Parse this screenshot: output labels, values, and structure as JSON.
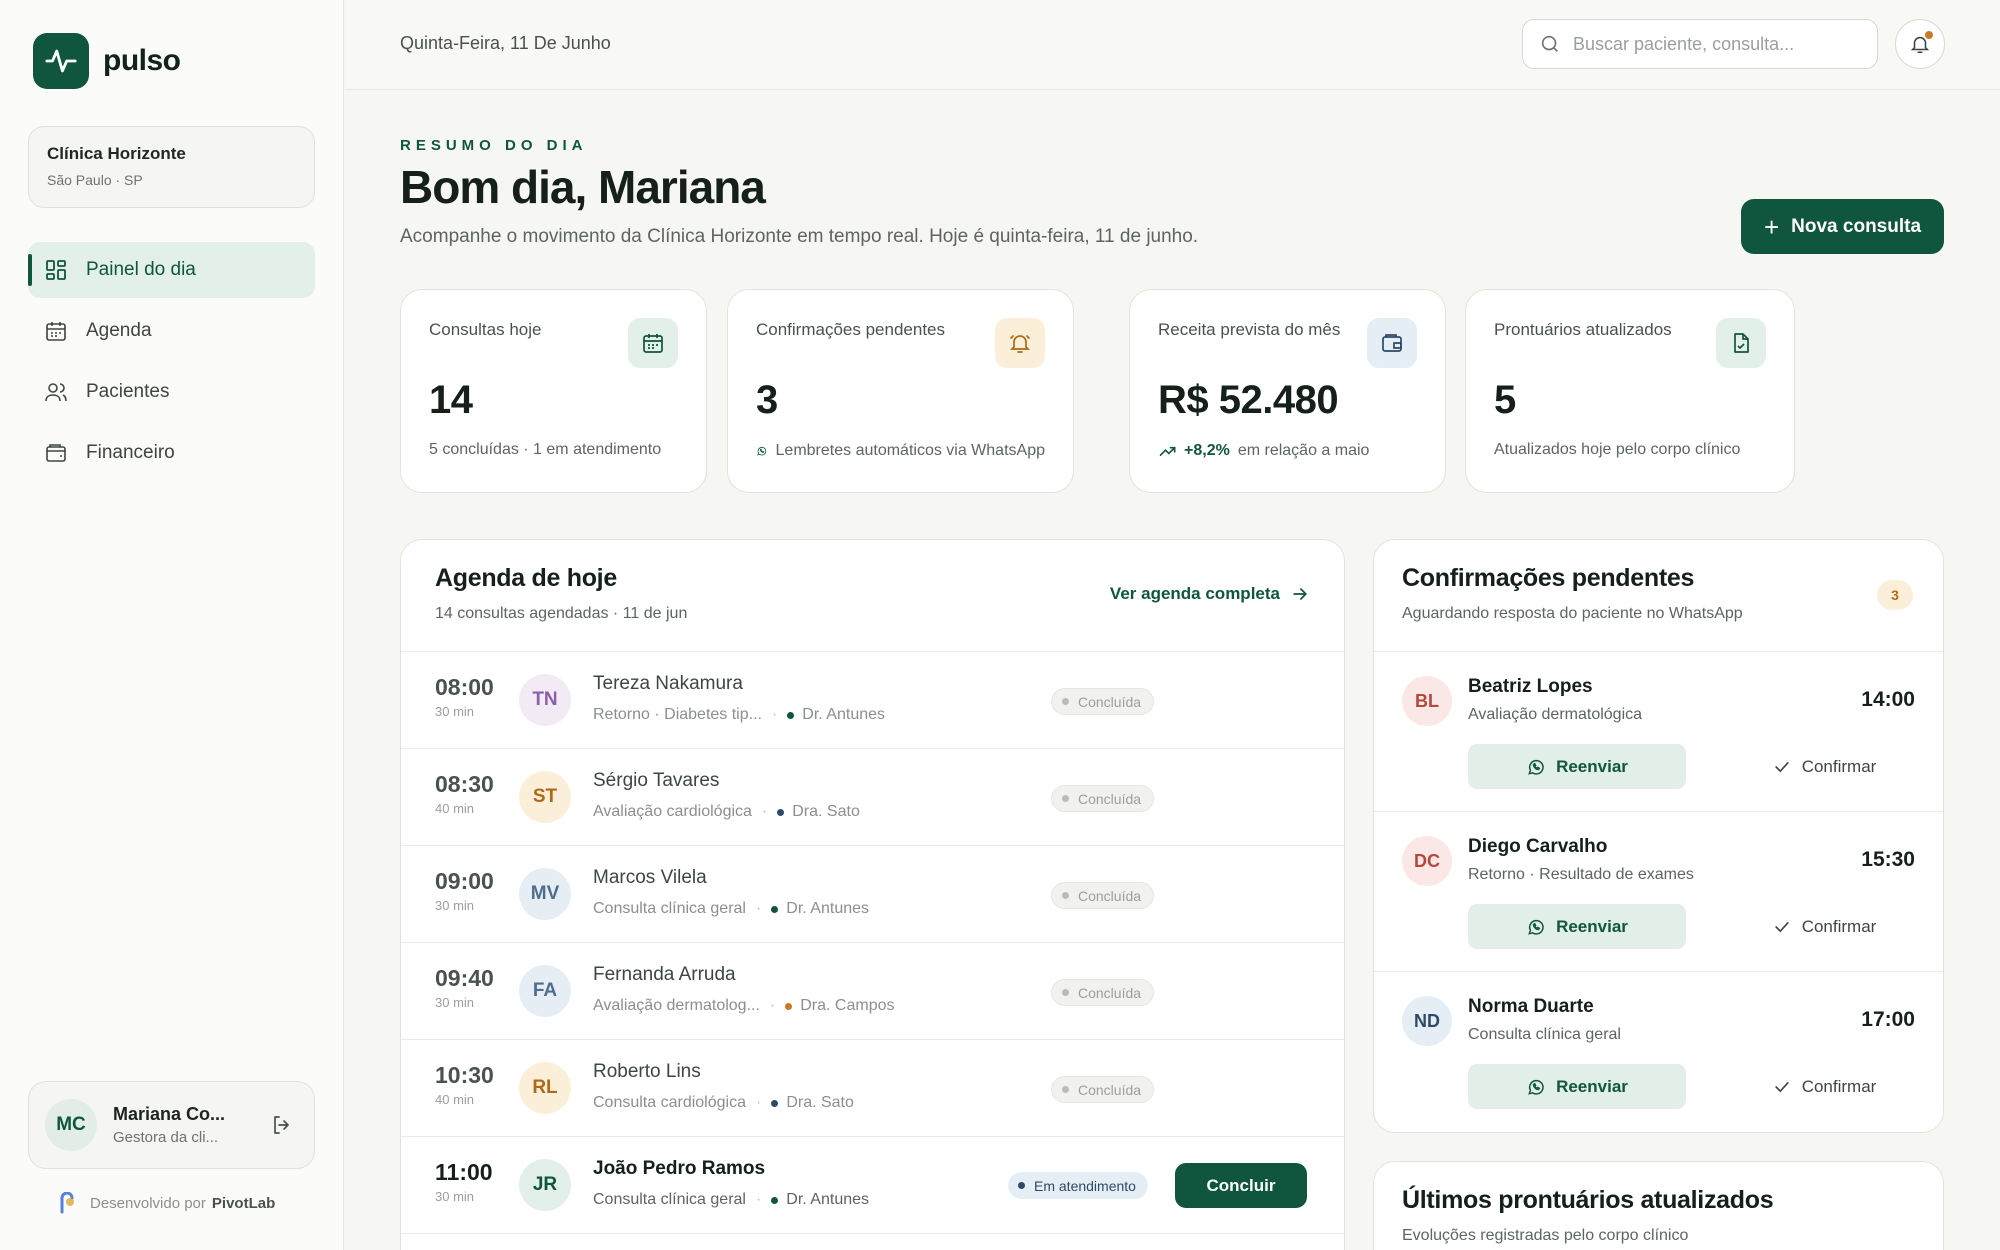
{
  "app": {
    "name": "pulso"
  },
  "clinic": {
    "name": "Clínica Horizonte",
    "location": "São Paulo · SP"
  },
  "nav": [
    {
      "label": "Painel do dia",
      "icon": "dashboard-icon",
      "active": true
    },
    {
      "label": "Agenda",
      "icon": "calendar-icon",
      "active": false
    },
    {
      "label": "Pacientes",
      "icon": "users-icon",
      "active": false
    },
    {
      "label": "Financeiro",
      "icon": "wallet-icon",
      "active": false
    }
  ],
  "user": {
    "initials": "MC",
    "name": "Mariana Co...",
    "role": "Gestora da cli..."
  },
  "credit": {
    "prefix": "Desenvolvido por",
    "brand": "PivotLab"
  },
  "topbar": {
    "date": "Quinta-Feira, 11 De Junho",
    "search_placeholder": "Buscar paciente, consulta..."
  },
  "header": {
    "eyebrow": "RESUMO DO DIA",
    "greeting": "Bom dia, Mariana",
    "subtitle": "Acompanhe o movimento da Clínica Horizonte em tempo real. Hoje é quinta-feira, 11 de junho.",
    "new_button": "Nova consulta"
  },
  "stats": [
    {
      "label": "Consultas hoje",
      "value": "14",
      "foot": "5 concluídas · 1 em atendimento",
      "icon": "calendar-icon"
    },
    {
      "label": "Confirmações pendentes",
      "value": "3",
      "foot": "Lembretes automáticos via WhatsApp",
      "icon": "bell-icon"
    },
    {
      "label": "Receita prevista do mês",
      "value": "R$ 52.480",
      "trend": "+8,2%",
      "foot": "em relação a maio",
      "icon": "wallet-icon"
    },
    {
      "label": "Prontuários atualizados",
      "value": "5",
      "foot": "Atualizados hoje pelo corpo clínico",
      "icon": "document-icon"
    }
  ],
  "agenda": {
    "title": "Agenda de hoje",
    "subtitle": "14 consultas agendadas · 11 de jun",
    "link": "Ver agenda completa",
    "rows": [
      {
        "time": "08:00",
        "duration": "30 min",
        "initials": "TN",
        "patient": "Tereza Nakamura",
        "procedure": "Retorno · Diabetes tip...",
        "doctor": "Dr. Antunes",
        "status": "Concluída"
      },
      {
        "time": "08:30",
        "duration": "40 min",
        "initials": "ST",
        "patient": "Sérgio Tavares",
        "procedure": "Avaliação cardiológica",
        "doctor": "Dra. Sato",
        "status": "Concluída"
      },
      {
        "time": "09:00",
        "duration": "30 min",
        "initials": "MV",
        "patient": "Marcos Vilela",
        "procedure": "Consulta clínica geral",
        "doctor": "Dr. Antunes",
        "status": "Concluída"
      },
      {
        "time": "09:40",
        "duration": "30 min",
        "initials": "FA",
        "patient": "Fernanda Arruda",
        "procedure": "Avaliação dermatolog...",
        "doctor": "Dra. Campos",
        "status": "Concluída"
      },
      {
        "time": "10:30",
        "duration": "40 min",
        "initials": "RL",
        "patient": "Roberto Lins",
        "procedure": "Consulta cardiológica",
        "doctor": "Dra. Sato",
        "status": "Concluída"
      },
      {
        "time": "11:00",
        "duration": "30 min",
        "initials": "JR",
        "patient": "João Pedro Ramos",
        "procedure": "Consulta clínica geral",
        "doctor": "Dr. Antunes",
        "status": "Em atendimento",
        "action": "Concluir"
      }
    ]
  },
  "confirmations": {
    "title": "Confirmações pendentes",
    "subtitle": "Aguardando resposta do paciente no WhatsApp",
    "count": "3",
    "resend_label": "Reenviar",
    "confirm_label": "Confirmar",
    "items": [
      {
        "initials": "BL",
        "name": "Beatriz Lopes",
        "procedure": "Avaliação dermatológica",
        "time": "14:00"
      },
      {
        "initials": "DC",
        "name": "Diego Carvalho",
        "procedure": "Retorno · Resultado de exames",
        "time": "15:30"
      },
      {
        "initials": "ND",
        "name": "Norma Duarte",
        "procedure": "Consulta clínica geral",
        "time": "17:00"
      }
    ]
  },
  "records": {
    "title": "Últimos prontuários atualizados",
    "subtitle": "Evoluções registradas pelo corpo clínico"
  },
  "colors": {
    "brand": "#10563f",
    "brand_light": "#e3efe9",
    "warning": "#c97a28"
  }
}
